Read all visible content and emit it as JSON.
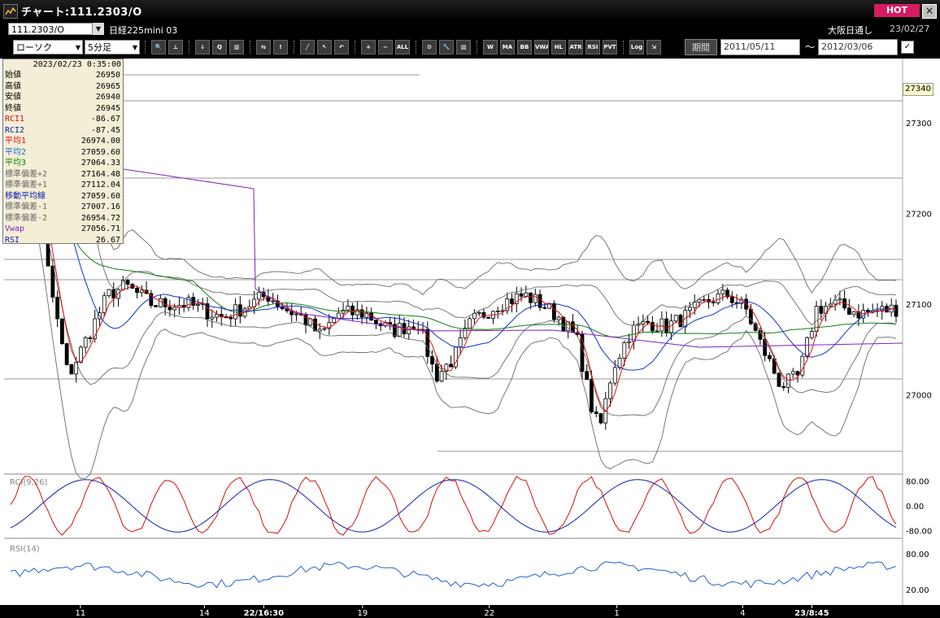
{
  "window": {
    "title": "チャート:111.2303/O",
    "hot_label": "HOT",
    "close_label": "×"
  },
  "header": {
    "symbol": "111.2303/O",
    "instrument": "日経225mini 03",
    "session": "大阪日通し",
    "date": "23/02/27"
  },
  "toolbar": {
    "chart_type": "ローソク",
    "timeframe": "5分足",
    "buttons": [
      {
        "name": "zoom-icon",
        "label": "🔍"
      },
      {
        "name": "cursor-tool-icon",
        "label": "⊥"
      },
      {
        "name": "download-icon",
        "label": "↓"
      },
      {
        "name": "search-chart-icon",
        "label": "Q"
      },
      {
        "name": "bar-chart-icon",
        "label": "▥"
      },
      {
        "name": "compare-icon",
        "label": "⇆"
      },
      {
        "name": "alert-icon",
        "label": "!"
      },
      {
        "name": "draw-line-icon",
        "label": "╱"
      },
      {
        "name": "pointer-icon",
        "label": "↖"
      },
      {
        "name": "undo-icon",
        "label": "↶"
      },
      {
        "name": "zoom-in-icon",
        "label": "+"
      },
      {
        "name": "zoom-out-icon",
        "label": "−"
      },
      {
        "name": "all-icon",
        "label": "ALL"
      },
      {
        "name": "settings-icon",
        "label": "⚙"
      },
      {
        "name": "wrench-icon",
        "label": "🔧"
      },
      {
        "name": "color-icon",
        "label": "▧"
      },
      {
        "name": "indicator-icon",
        "label": "W"
      },
      {
        "name": "ma-icon",
        "label": "MA"
      },
      {
        "name": "bb-icon",
        "label": "BB"
      },
      {
        "name": "vwap-icon",
        "label": "VWAP"
      },
      {
        "name": "hl-icon",
        "label": "HL"
      },
      {
        "name": "atr-icon",
        "label": "ATR"
      },
      {
        "name": "rsi-icon",
        "label": "RSI"
      },
      {
        "name": "pvt-icon",
        "label": "PVT"
      },
      {
        "name": "log-icon",
        "label": "Log"
      },
      {
        "name": "export-icon",
        "label": "⇲"
      }
    ],
    "period_label": "期間",
    "date_from": "2011/05/11",
    "date_to": "2012/03/06",
    "tilde": "～"
  },
  "colors": {
    "candle": "#000000",
    "avg1": "#e01010",
    "avg2": "#1030d0",
    "avg3": "#108010",
    "bb": "#6a6a6a",
    "vwap": "#8020c0",
    "rci1": "#d01010",
    "rci2": "#1020b0",
    "rsi": "#2060d0"
  },
  "info_panel": {
    "datetime": "2023/02/23  0:35:00",
    "rows": [
      {
        "label": "始値",
        "value": "26950",
        "color": "#000000"
      },
      {
        "label": "高値",
        "value": "26965",
        "color": "#000000"
      },
      {
        "label": "安値",
        "value": "26940",
        "color": "#000000"
      },
      {
        "label": "終値",
        "value": "26945",
        "color": "#000000"
      },
      {
        "label": "RCI1",
        "value": "-86.67",
        "color": "#d01010"
      },
      {
        "label": "RCI2",
        "value": "-87.45",
        "color": "#1020b0"
      },
      {
        "label": "平均1",
        "value": "26974.00",
        "color": "#e01010"
      },
      {
        "label": "平均2",
        "value": "27059.60",
        "color": "#1070d0"
      },
      {
        "label": "平均3",
        "value": "27064.33",
        "color": "#108010"
      },
      {
        "label": "標準偏差+2",
        "value": "27164.48",
        "color": "#666666"
      },
      {
        "label": "標準偏差+1",
        "value": "27112.04",
        "color": "#666666"
      },
      {
        "label": "移動平均線",
        "value": "27059.60",
        "color": "#1020b0"
      },
      {
        "label": "標準偏差-1",
        "value": "27007.16",
        "color": "#666666"
      },
      {
        "label": "標準偏差-2",
        "value": "26954.72",
        "color": "#666666"
      },
      {
        "label": "Vwap",
        "value": "27056.71",
        "color": "#8020c0"
      },
      {
        "label": "RSI",
        "value": "26.67",
        "color": "#1020b0"
      }
    ]
  },
  "price_axis": {
    "last_price": "27340",
    "ticks": [
      "27300",
      "27200",
      "27100",
      "27000"
    ],
    "values": [
      27300,
      27200,
      27100,
      27000
    ]
  },
  "rci_panel": {
    "title": "RCI(9,26)",
    "ticks": [
      "80.00",
      "0.00",
      "-80.00"
    ]
  },
  "rsi_panel": {
    "title": "RSI(14)",
    "ticks": [
      "80.00",
      "20.00"
    ]
  },
  "x_axis": {
    "labels": [
      {
        "text": "11",
        "pos": 0.085
      },
      {
        "text": "14",
        "pos": 0.223
      },
      {
        "text": "22/16:30",
        "pos": 0.289,
        "bold": true
      },
      {
        "text": "19",
        "pos": 0.399
      },
      {
        "text": "22",
        "pos": 0.54
      },
      {
        "text": "1",
        "pos": 0.682
      },
      {
        "text": "4",
        "pos": 0.822
      },
      {
        "text": "23/8:45",
        "pos": 0.899,
        "bold": true
      }
    ]
  }
}
